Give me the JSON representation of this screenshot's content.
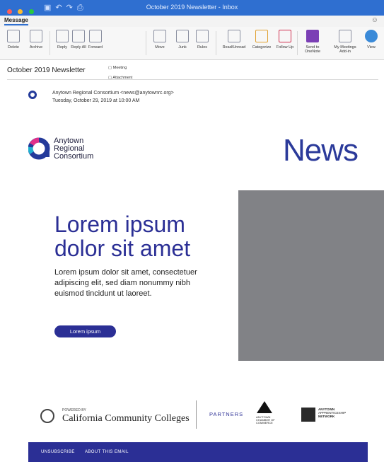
{
  "window": {
    "title": "October 2019 Newsletter - Inbox",
    "colors": {
      "close": "#ff5f57",
      "minimize": "#febc2e",
      "zoom": "#28c840",
      "titlebar": "#2f6fd0"
    }
  },
  "ribbon": {
    "active_tab": "Message",
    "buttons": [
      {
        "name": "delete",
        "label": "Delete"
      },
      {
        "name": "archive",
        "label": "Archive"
      },
      {
        "name": "reply",
        "label": "Reply"
      },
      {
        "name": "reply-all",
        "label": "Reply All"
      },
      {
        "name": "forward",
        "label": "Forward"
      },
      {
        "name": "move",
        "label": "Move"
      },
      {
        "name": "junk",
        "label": "Junk"
      },
      {
        "name": "rules",
        "label": "Rules"
      },
      {
        "name": "read-unread",
        "label": "Read/Unread"
      },
      {
        "name": "categorize",
        "label": "Categorize"
      },
      {
        "name": "follow-up",
        "label": "Follow Up"
      },
      {
        "name": "send-to-onenote",
        "label": "Send to OneNote"
      },
      {
        "name": "my-meetings",
        "label": "My Meetings Add-in"
      },
      {
        "name": "view",
        "label": "View"
      }
    ],
    "meeting_label": "Meeting",
    "attachment_label": "Attachment"
  },
  "message": {
    "subject": "October 2019 Newsletter",
    "from": "Anytown Regional Consortium <news@anytownrc.org>",
    "date": "Tuesday, October 29, 2019 at 10:00 AM"
  },
  "newsletter": {
    "org_name_line1": "Anytown",
    "org_name_line2": "Regional",
    "org_name_line3": "Consortium",
    "news_label": "News",
    "headline": "Lorem ipsum dolor sit amet",
    "body": "Lorem ipsum dolor sit amet, consectetuer adipiscing elit, sed diam nonummy nibh euismod tincidunt ut laoreet.",
    "cta_label": "Lorem ipsum",
    "powered_by": "POWERED BY",
    "cc_name": "California Community Colleges",
    "partners_label": "PARTNERS",
    "partner1": "ANYTOWN CHAMBER OF COMMERCE",
    "partner2_line1": "ANYTOWN",
    "partner2_line2": "APPRENTICESHIP",
    "partner2_line3": "NETWORK",
    "footer_unsubscribe": "UNSUBSCRIBE",
    "footer_about": "ABOUT THIS EMAIL",
    "brand_color": "#2b2f95"
  }
}
